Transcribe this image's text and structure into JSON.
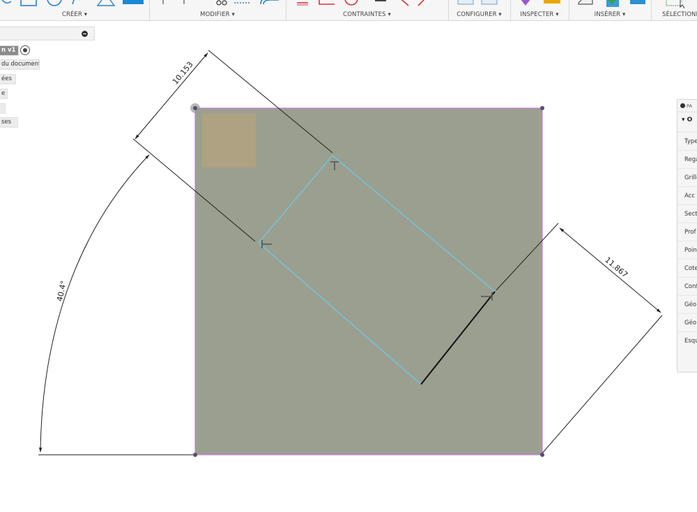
{
  "toolbar": {
    "groups": [
      {
        "label": "CRÉER ▾"
      },
      {
        "label": "MODIFIER ▾"
      },
      {
        "label": "CONTRAINTES ▾"
      },
      {
        "label": "CONFIGURER ▾"
      },
      {
        "label": "INSPECTER ▾"
      },
      {
        "label": "INSÉRER ▾"
      },
      {
        "label": "SÉLECTIONNER ▾"
      }
    ]
  },
  "browser": {
    "items": [
      {
        "label": "n v1"
      },
      {
        "label": "du document"
      },
      {
        "label": "ées"
      },
      {
        "label": "e"
      },
      {
        "label": ""
      },
      {
        "label": "ses"
      }
    ]
  },
  "palette": {
    "header": "PA",
    "section": "▾ O",
    "rows": [
      {
        "label": "Type"
      },
      {
        "label": "Rega"
      },
      {
        "label": "Grille"
      },
      {
        "label": "Acc"
      },
      {
        "label": "Sect"
      },
      {
        "label": "Prof"
      },
      {
        "label": "Point"
      },
      {
        "label": "Cote"
      },
      {
        "label": "Conf"
      },
      {
        "label": "Géo"
      },
      {
        "label": "Géo"
      },
      {
        "label": "Esqu"
      }
    ]
  },
  "sketch": {
    "dimensions": {
      "top": "10.153",
      "right": "11.867",
      "angle": "40.4°"
    },
    "colors": {
      "profile_fill": "#8d9281",
      "profile_edge": "#c77ee0",
      "line_blue": "#6ec9e6",
      "dimension": "#1e1e1e",
      "point": "#5c4b6b"
    }
  }
}
